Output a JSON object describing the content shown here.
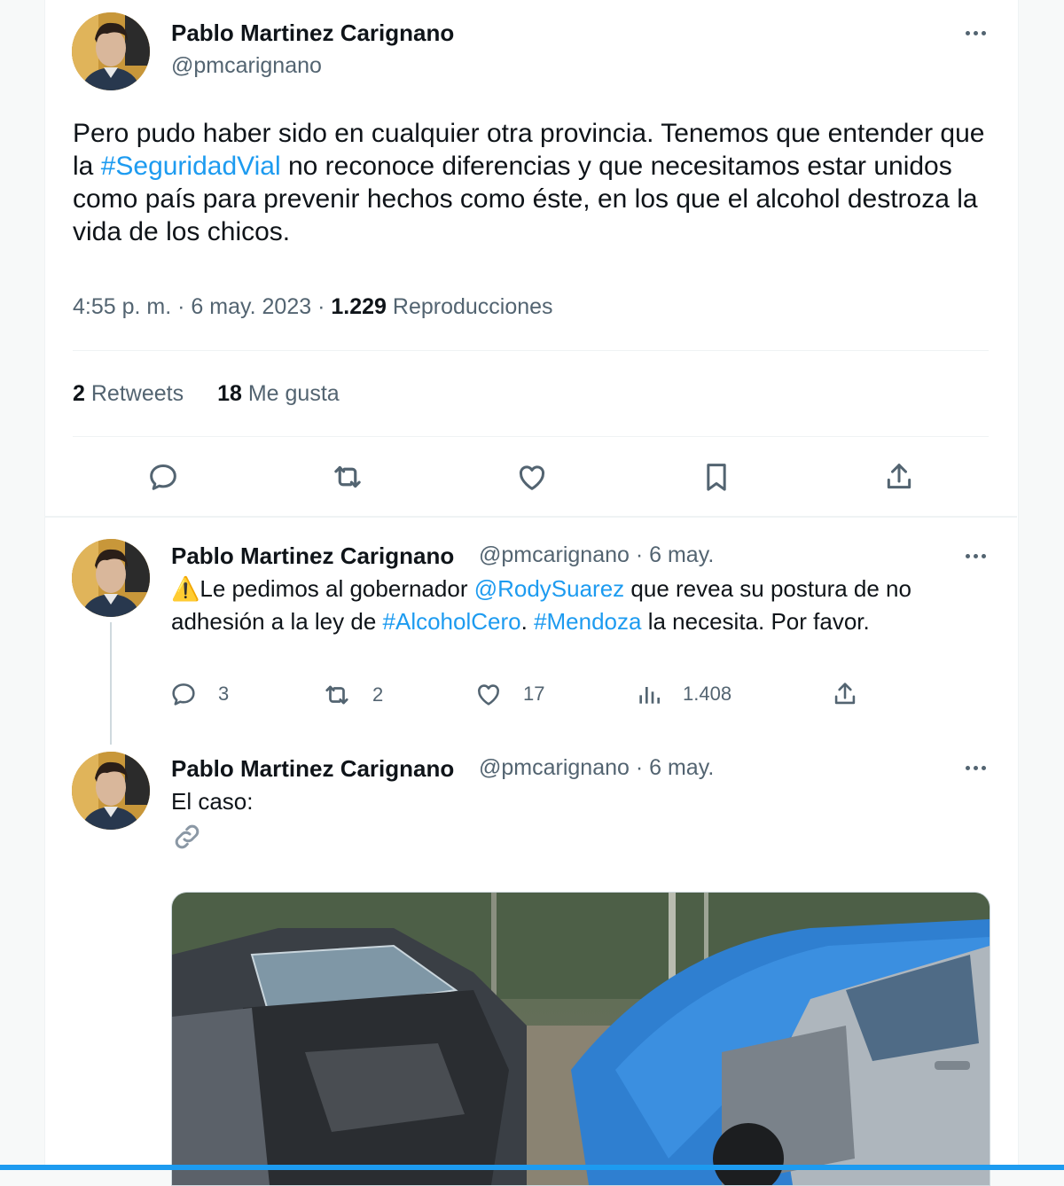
{
  "author": {
    "name": "Pablo Martinez Carignano",
    "handle": "@pmcarignano"
  },
  "main_tweet": {
    "text_part1": "Pero pudo haber sido en cualquier otra provincia. Tenemos que entender que la ",
    "hashtag": "#SeguridadVial",
    "text_part2": " no reconoce diferencias y que necesitamos estar unidos como país para prevenir hechos como éste, en los que el alcohol destroza la vida de los chicos.",
    "time": "4:55 p. m.",
    "date": "6 may. 2023",
    "dot": "·",
    "views_count": "1.229",
    "views_label": "Reproducciones",
    "retweets_count": "2",
    "retweets_label": "Retweets",
    "likes_count": "18",
    "likes_label": "Me gusta"
  },
  "reply1": {
    "meta": "@pmcarignano · 6 may.",
    "warning_emoji": "⚠️",
    "text_a": "Le pedimos al gobernador ",
    "mention": "@RodySuarez",
    "text_b": " que revea su postura de no adhesión a la ley de ",
    "hashtag1": "#AlcoholCero",
    "text_c": ". ",
    "hashtag2": "#Mendoza",
    "text_d": " la necesita. Por favor.",
    "replies": "3",
    "retweets": "2",
    "likes": "17",
    "views": "1.408"
  },
  "reply2": {
    "meta": "@pmcarignano · 6 may.",
    "text": "El caso:"
  },
  "icons": {
    "reply": "reply-icon",
    "retweet": "retweet-icon",
    "like": "heart-icon",
    "bookmark": "bookmark-icon",
    "share": "share-icon",
    "views": "views-icon",
    "link": "link-icon",
    "more": "more-icon"
  },
  "colors": {
    "accent": "#1d9bf0",
    "text": "#0f1419",
    "muted": "#536471"
  }
}
